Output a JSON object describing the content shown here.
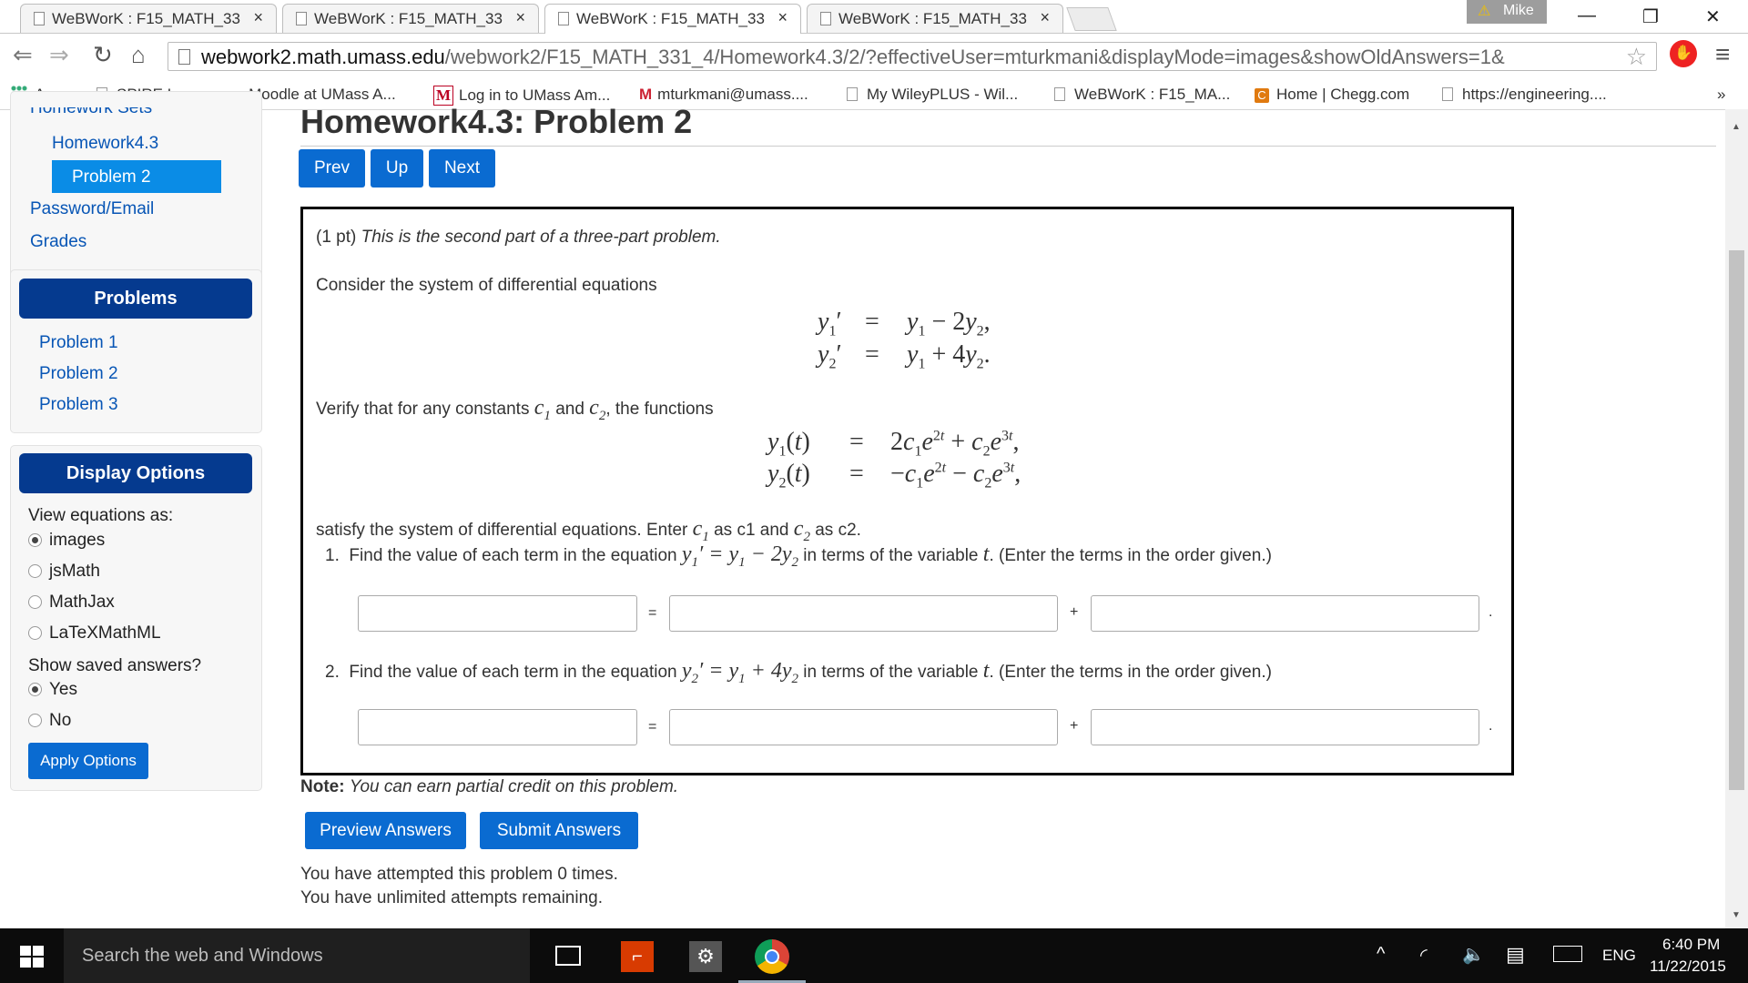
{
  "browser": {
    "tabs": [
      {
        "title": "WeBWorK : F15_MATH_33",
        "active": false
      },
      {
        "title": "WeBWorK : F15_MATH_33",
        "active": false
      },
      {
        "title": "WeBWorK : F15_MATH_33",
        "active": true
      },
      {
        "title": "WeBWorK : F15_MATH_33",
        "active": false
      }
    ],
    "tab_close": "×",
    "profile_name": "Mike",
    "url_host": "webwork2.math.umass.edu",
    "url_path": "/webwork2/F15_MATH_331_4/Homework4.3/2/?effectiveUser=mturkmani&displayMode=images&showOldAnswers=1&",
    "bookmarks": [
      "Apps",
      "SPIRE Logon",
      "Moodle at UMass A...",
      "Log in to UMass Am...",
      "mturkmani@umass....",
      "My WileyPLUS - Wil...",
      "WeBWorK : F15_MA...",
      "Home | Chegg.com",
      "https://engineering...."
    ],
    "bookmarks_more": "»"
  },
  "sidebar": {
    "partial_top": "Homework Sets",
    "set_link": "Homework4.3",
    "selected": "Problem 2",
    "password_link": "Password/Email",
    "grades_link": "Grades",
    "problems_header": "Problems",
    "problems": [
      "Problem 1",
      "Problem 2",
      "Problem 3"
    ],
    "display_header": "Display Options",
    "view_eq_label": "View equations as:",
    "eq_options": [
      "images",
      "jsMath",
      "MathJax",
      "LaTeXMathML"
    ],
    "eq_selected": "images",
    "saved_label": "Show saved answers?",
    "saved_options": [
      "Yes",
      "No"
    ],
    "saved_selected": "Yes",
    "apply_button": "Apply Options"
  },
  "main": {
    "title": "Homework4.3: Problem 2",
    "prev": "Prev",
    "up": "Up",
    "next": "Next",
    "points": "(1 pt)",
    "intro_italic": "This is the second part of a three-part problem.",
    "consider": "Consider the system of differential equations",
    "verify_pre": "Verify that for any constants",
    "verify_and": "and",
    "verify_post": ", the functions",
    "satisfy_pre": "satisfy the system of differential equations. Enter",
    "satisfy_as1": "as c1 and",
    "satisfy_as2": "as c2.",
    "q1_num": "1.",
    "q1_pre": "Find the value of each term in the equation",
    "q1_post": "in terms of the variable",
    "q1_tail": ". (Enter the terms in the order given.)",
    "q2_num": "2.",
    "q2_pre": "Find the value of each term in the equation",
    "q2_post": "in terms of the variable",
    "q2_tail": ". (Enter the terms in the order given.)",
    "op_eq": "=",
    "op_plus": "+",
    "op_dot": ".",
    "answers_q1": [
      "",
      "",
      ""
    ],
    "answers_q2": [
      "",
      "",
      ""
    ],
    "note_label": "Note:",
    "note_text": "You can earn partial credit on this problem.",
    "preview_button": "Preview Answers",
    "submit_button": "Submit Answers",
    "attempts_line1": "You have attempted this problem 0 times.",
    "attempts_line2": "You have unlimited attempts remaining."
  },
  "taskbar": {
    "search_placeholder": "Search the web and Windows",
    "language": "ENG",
    "time": "6:40 PM",
    "date": "11/22/2015"
  }
}
